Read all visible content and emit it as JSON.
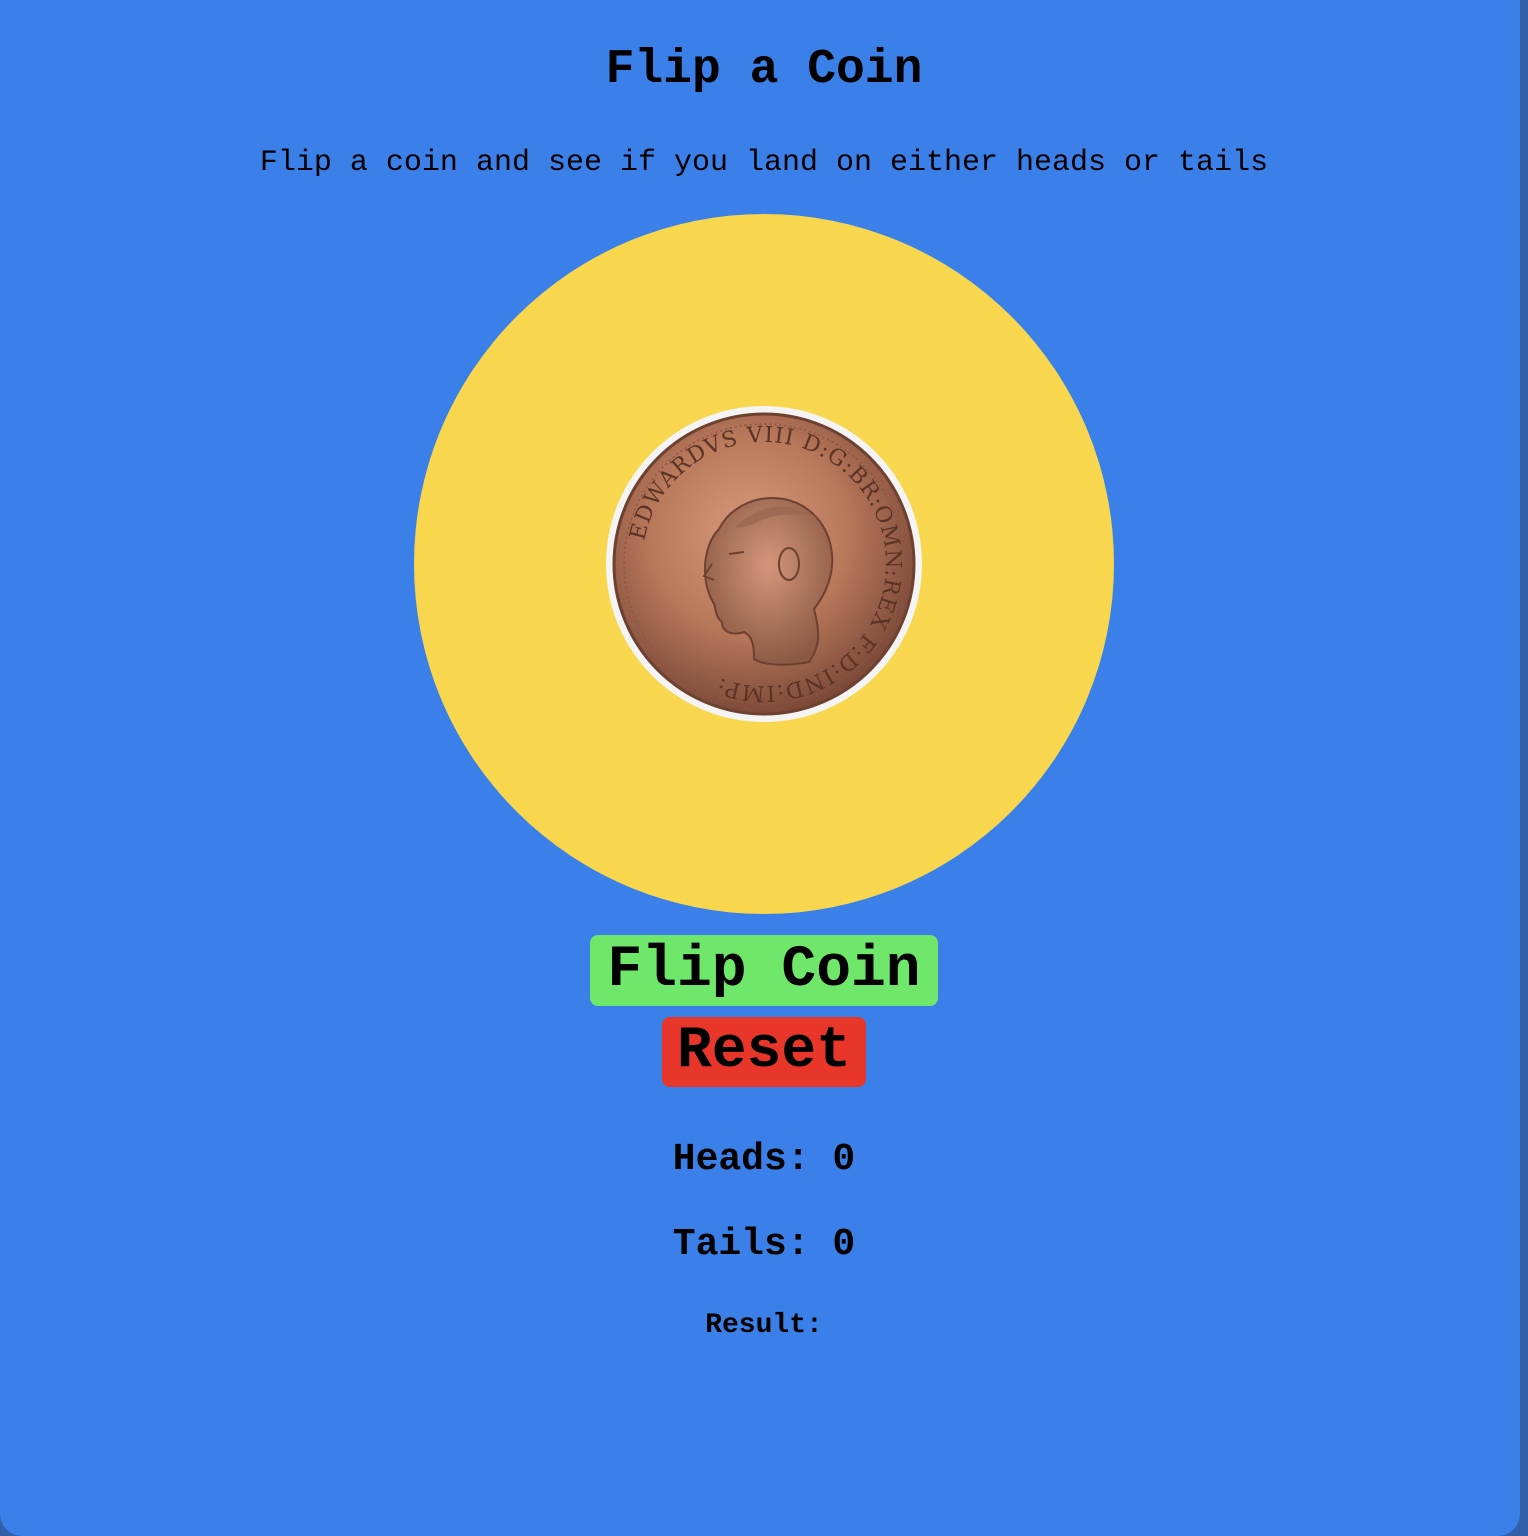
{
  "page": {
    "title": "Flip a Coin",
    "subtitle": "Flip a coin and see if you land on either heads or tails"
  },
  "coin": {
    "image_name": "coin-heads-image",
    "inscription_top": "EDWARDVS VIII D:G:BR:OMN:REX F:D:IND:IMP:",
    "colors": {
      "stage": "#f8d74f",
      "coin_copper": "#b8785a"
    }
  },
  "buttons": {
    "flip_label": "Flip Coin",
    "reset_label": "Reset"
  },
  "stats": {
    "heads_label": "Heads:",
    "heads_value": "0",
    "tails_label": "Tails:",
    "tails_value": "0",
    "result_label": "Result:",
    "result_value": ""
  },
  "colors": {
    "background": "#3a80e8",
    "flip_button": "#6fe76a",
    "reset_button": "#e8362a"
  }
}
